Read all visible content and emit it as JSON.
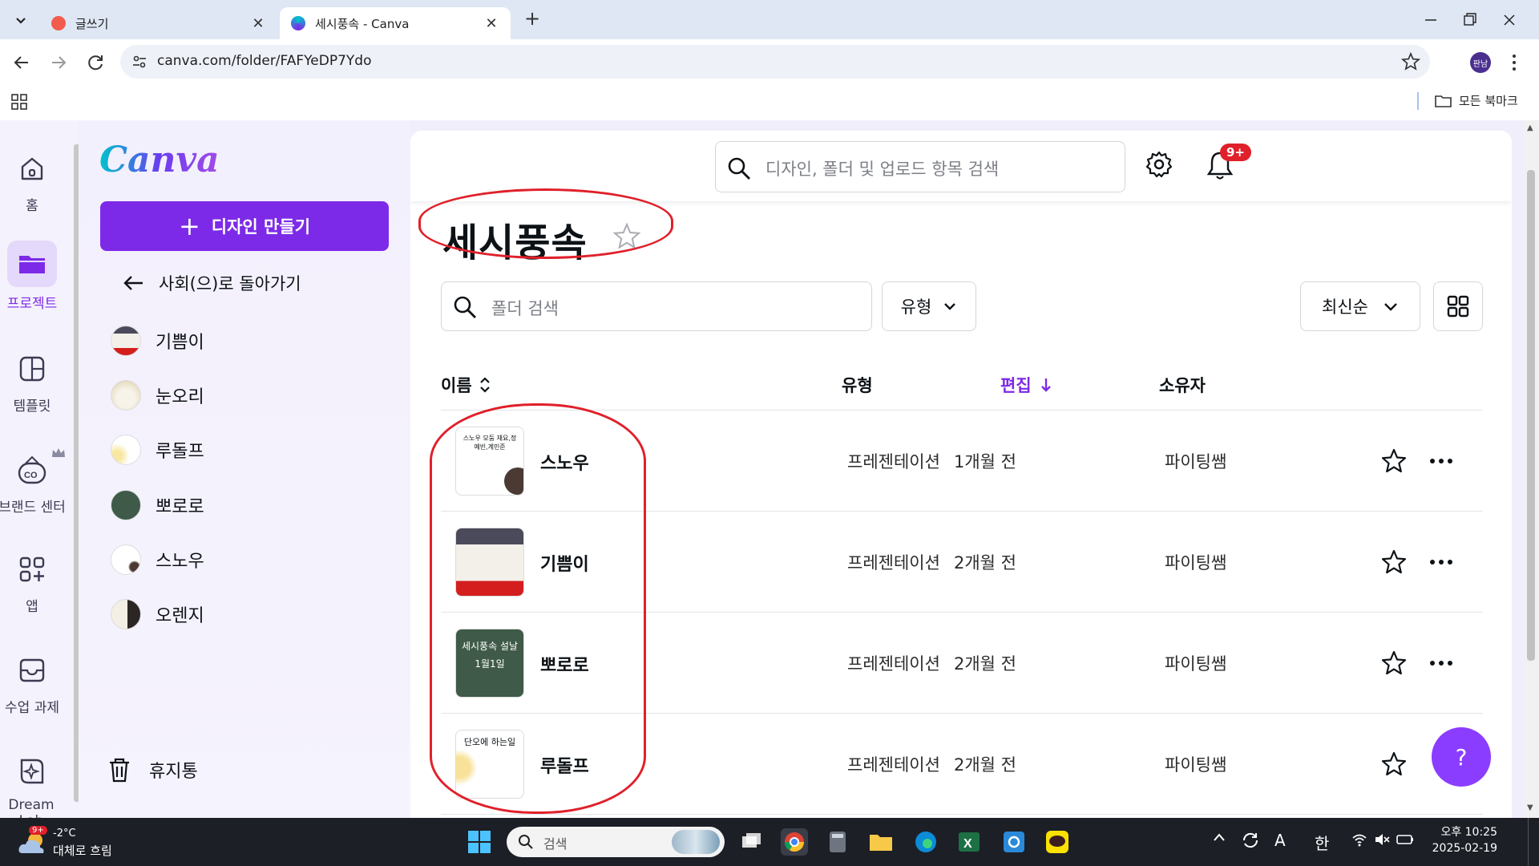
{
  "browser": {
    "tabs": [
      {
        "title": "글쓰기",
        "active": false
      },
      {
        "title": "세시풍속 - Canva",
        "active": true
      }
    ],
    "url": "canva.com/folder/FAFYeDP7Ydo",
    "profile_label": "판남",
    "bookmarks_label": "모든 북마크"
  },
  "rail": {
    "items": [
      {
        "label": "홈",
        "icon": "home-icon"
      },
      {
        "label": "프로젝트",
        "icon": "folder-icon",
        "active": true
      },
      {
        "label": "템플릿",
        "icon": "template-icon"
      },
      {
        "label": "브랜드 센터",
        "icon": "brand-icon"
      },
      {
        "label": "앱",
        "icon": "apps-icon"
      },
      {
        "label": "수업 과제",
        "icon": "inbox-icon"
      },
      {
        "label": "Dream Lab",
        "icon": "dreamlab-icon"
      }
    ]
  },
  "side": {
    "logo": "Canva",
    "create_label": "디자인 만들기",
    "back_label": "사회(으)로 돌아가기",
    "items": [
      "기쁨이",
      "눈오리",
      "루돌프",
      "뽀로로",
      "스노우",
      "오렌지"
    ],
    "trash_label": "휴지통"
  },
  "header": {
    "search_placeholder": "디자인, 폴더 및 업로드 항목 검색",
    "notif_badge": "9+"
  },
  "folder": {
    "title": "세시풍속",
    "search_placeholder": "폴더 검색",
    "type_filter": "유형",
    "sort_label": "최신순"
  },
  "table": {
    "columns": {
      "name": "이름",
      "type": "유형",
      "edited": "편집",
      "owner": "소유자"
    },
    "rows": [
      {
        "name": "스노우",
        "type": "프레젠테이션",
        "edited": "1개월 전",
        "owner": "파이팅쌤",
        "thumb_text": "스노우 모둠 재요,정예빈,계민준"
      },
      {
        "name": "기쁨이",
        "type": "프레젠테이션",
        "edited": "2개월 전",
        "owner": "파이팅쌤",
        "thumb_text": ""
      },
      {
        "name": "뽀로로",
        "type": "프레젠테이션",
        "edited": "2개월 전",
        "owner": "파이팅쌤",
        "thumb_text": "세시풍속 설날 1월1일"
      },
      {
        "name": "루돌프",
        "type": "프레젠테이션",
        "edited": "2개월 전",
        "owner": "파이팅쌤",
        "thumb_text": "단오에 하는일"
      }
    ]
  },
  "help_label": "?",
  "taskbar": {
    "weather_temp": "-2°C",
    "weather_desc": "대체로 흐림",
    "weather_badge": "9+",
    "search_placeholder": "검색",
    "ime_a": "A",
    "ime_han": "한",
    "time": "오후 10:25",
    "date": "2025-02-19"
  },
  "colors": {
    "accent": "#7d2ae8",
    "annotation": "#e0202a"
  }
}
